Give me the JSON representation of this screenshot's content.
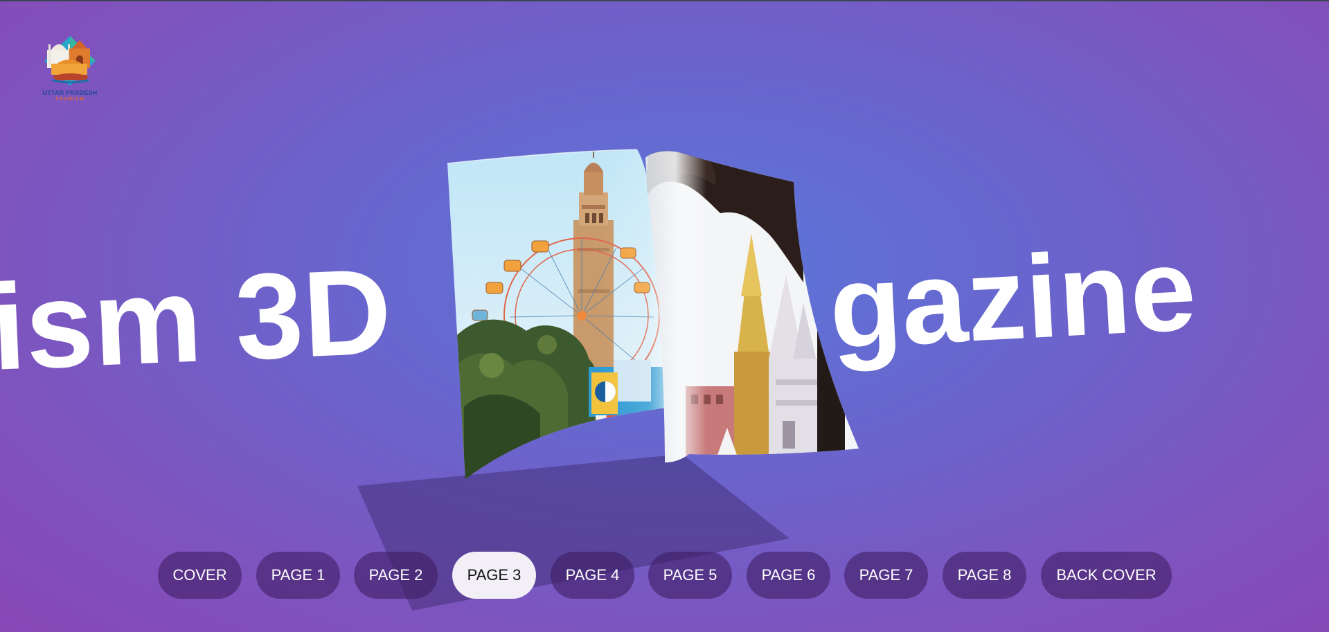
{
  "logo": {
    "title": "UTTAR PRADESH",
    "subtitle": "TOURISM"
  },
  "headline": {
    "left_text": "ism 3D",
    "right_text": "gazine"
  },
  "page_nav": {
    "items": [
      {
        "label": "COVER",
        "active": false
      },
      {
        "label": "PAGE 1",
        "active": false
      },
      {
        "label": "PAGE 2",
        "active": false
      },
      {
        "label": "PAGE 3",
        "active": true
      },
      {
        "label": "PAGE 4",
        "active": false
      },
      {
        "label": "PAGE 5",
        "active": false
      },
      {
        "label": "PAGE 6",
        "active": false
      },
      {
        "label": "PAGE 7",
        "active": false
      },
      {
        "label": "PAGE 8",
        "active": false
      },
      {
        "label": "BACK COVER",
        "active": false
      }
    ]
  },
  "colors": {
    "background_center": "#5b77db",
    "background_edge": "#8846b4",
    "button_bg": "#3c1c60",
    "button_active_bg": "#f2eff7"
  }
}
